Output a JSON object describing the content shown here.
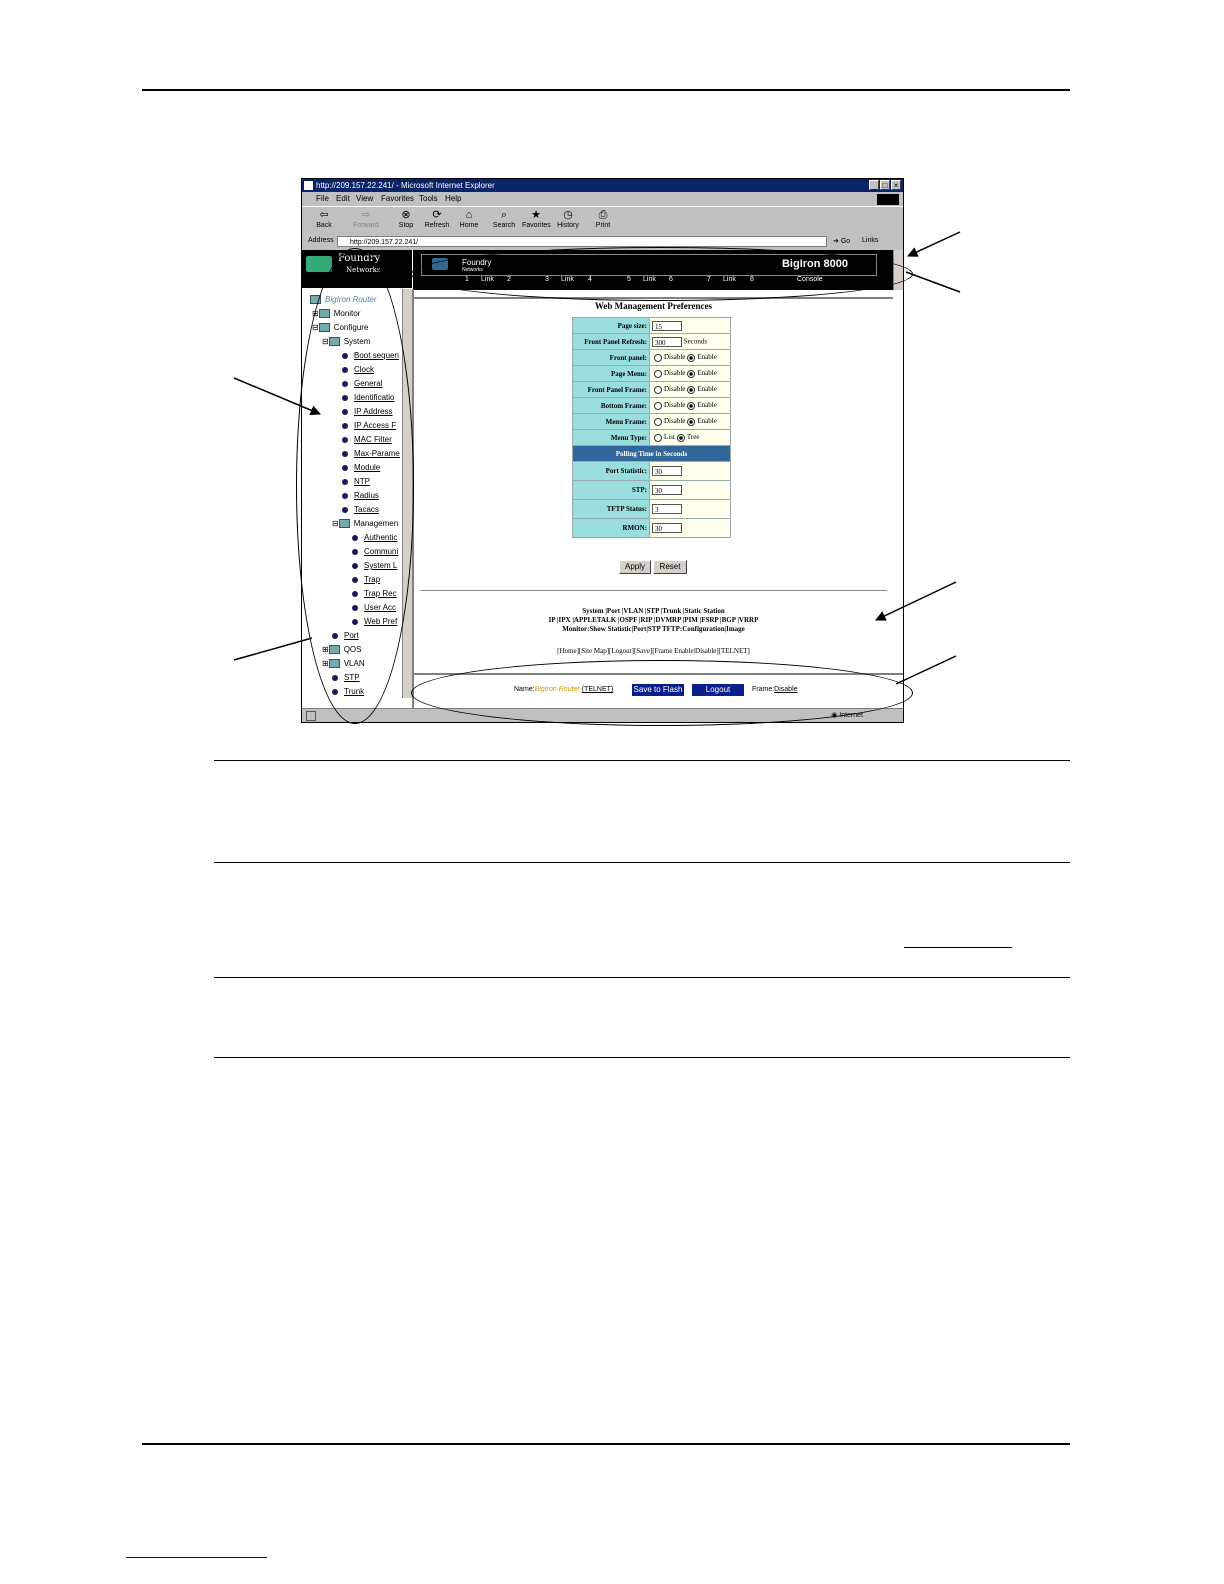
{
  "browser": {
    "title": "http://209.157.22.241/ - Microsoft Internet Explorer",
    "menu": [
      "File",
      "Edit",
      "View",
      "Favorites",
      "Tools",
      "Help"
    ],
    "toolbar": [
      "Back",
      "Forward",
      "Stop",
      "Refresh",
      "Home",
      "Search",
      "Favorites",
      "History",
      "Print"
    ],
    "address_label": "Address",
    "address_value": "http://209.157.22.241/",
    "go_label": "Go",
    "links_label": "Links",
    "status_zone": "Internet"
  },
  "logo": {
    "line1": "Foundry",
    "line2": "Networks"
  },
  "panel": {
    "brand": "Foundry",
    "brand_sub": "Networks",
    "model": "BigIron 8000",
    "ports": [
      "1",
      "Link",
      "2",
      "3",
      "Link",
      "4",
      "5",
      "Link",
      "6",
      "7",
      "Link",
      "8",
      "Console"
    ]
  },
  "nav": {
    "root": "BigIron Router",
    "items": [
      "Monitor",
      "Configure",
      "System",
      "Boot sequen",
      "Clock",
      "General",
      "Identificatio",
      "IP Address",
      "IP Access F",
      "MAC Filter",
      "Max-Parame",
      "Module",
      "NTP",
      "Radius",
      "Tacacs",
      "Managemen",
      "Authentic",
      "Communi",
      "System L",
      "Trap",
      "Trap Rec",
      "User Acc",
      "Web Pref",
      "Port",
      "QOS",
      "VLAN",
      "STP",
      "Trunk"
    ]
  },
  "prefs": {
    "title": "Web Management Preferences",
    "page_size_label": "Page size:",
    "page_size": "15",
    "refresh_label": "Front Panel Refresh:",
    "refresh": "300",
    "refresh_unit": "Seconds",
    "front_panel_label": "Front panel:",
    "page_menu_label": "Page Menu:",
    "front_panel_frame_label": "Front Panel Frame:",
    "bottom_frame_label": "Bottom Frame:",
    "menu_frame_label": "Menu Frame:",
    "menu_type_label": "Menu Type:",
    "disable": "Disable",
    "enable": "Enable",
    "list": "List",
    "tree": "Tree",
    "polling_header": "Polling Time in Seconds",
    "port_stat_label": "Port Statistic:",
    "port_stat": "30",
    "stp_label": "STP:",
    "stp": "30",
    "tftp_label": "TFTP Status:",
    "tftp": "3",
    "rmon_label": "RMON:",
    "rmon": "30",
    "apply": "Apply",
    "reset": "Reset"
  },
  "links": {
    "line1": "System |Port |VLAN |STP |Trunk |Static Station",
    "line2": "IP |IPX |APPLETALK |OSPF |RIP |DVMRP |PIM |FSRP |BGP |VRRP",
    "line3": "Monitor:Show Statistic|Port|STP TFTP:Configuration|Image",
    "line4": "[Home][Site Map][Logout][Save][Frame Enable|Disable][TELNET]"
  },
  "bottom": {
    "name_label": "Name:",
    "name_value": "BigIron Router",
    "telnet": "(TELNET)",
    "save_flash": "Save to Flash",
    "logout": "Logout",
    "frame_label": "Frame:",
    "frame_value": "Disable"
  }
}
